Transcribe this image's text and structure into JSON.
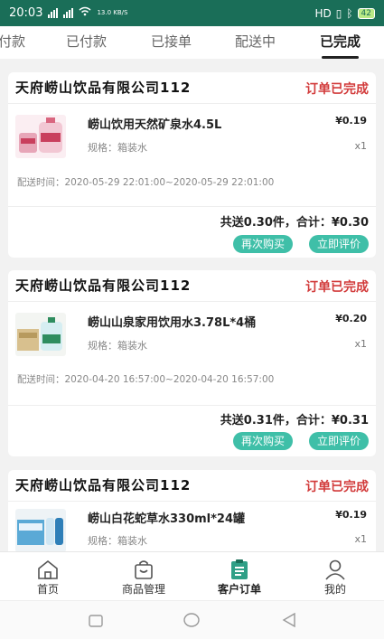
{
  "status_bar": {
    "time": "20:03",
    "net_speed": "13.0 KB/S",
    "carrier": "HD",
    "battery": "42"
  },
  "tabs": [
    "付款",
    "已付款",
    "已接单",
    "配送中",
    "已完成"
  ],
  "orders": [
    {
      "shop": "天府崂山饮品有限公司112",
      "status": "订单已完成",
      "product": "崂山饮用天然矿泉水4.5L",
      "spec": "规格：箱装水",
      "price": "¥0.19",
      "qty": "x1",
      "time": "配送时间：2020-05-29 22:01:00~2020-05-29 22:01:00",
      "total": "共送0.30件，合计：¥0.30",
      "btn_rebuy": "再次购买",
      "btn_review": "立即评价"
    },
    {
      "shop": "天府崂山饮品有限公司112",
      "status": "订单已完成",
      "product": "崂山山泉家用饮用水3.78L*4桶",
      "spec": "规格：箱装水",
      "price": "¥0.20",
      "qty": "x1",
      "time": "配送时间：2020-04-20 16:57:00~2020-04-20 16:57:00",
      "total": "共送0.31件，合计：¥0.31",
      "btn_rebuy": "再次购买",
      "btn_review": "立即评价"
    },
    {
      "shop": "天府崂山饮品有限公司112",
      "status": "订单已完成",
      "product": "崂山白花蛇草水330ml*24罐",
      "spec": "规格：箱装水",
      "price": "¥0.19",
      "qty": "x1"
    }
  ],
  "bottom_nav": [
    "首页",
    "商品管理",
    "客户订单",
    "我的"
  ],
  "colors": {
    "header": "#1a6e58",
    "accent": "#3fbfa8",
    "status_red": "#d23b3b"
  }
}
